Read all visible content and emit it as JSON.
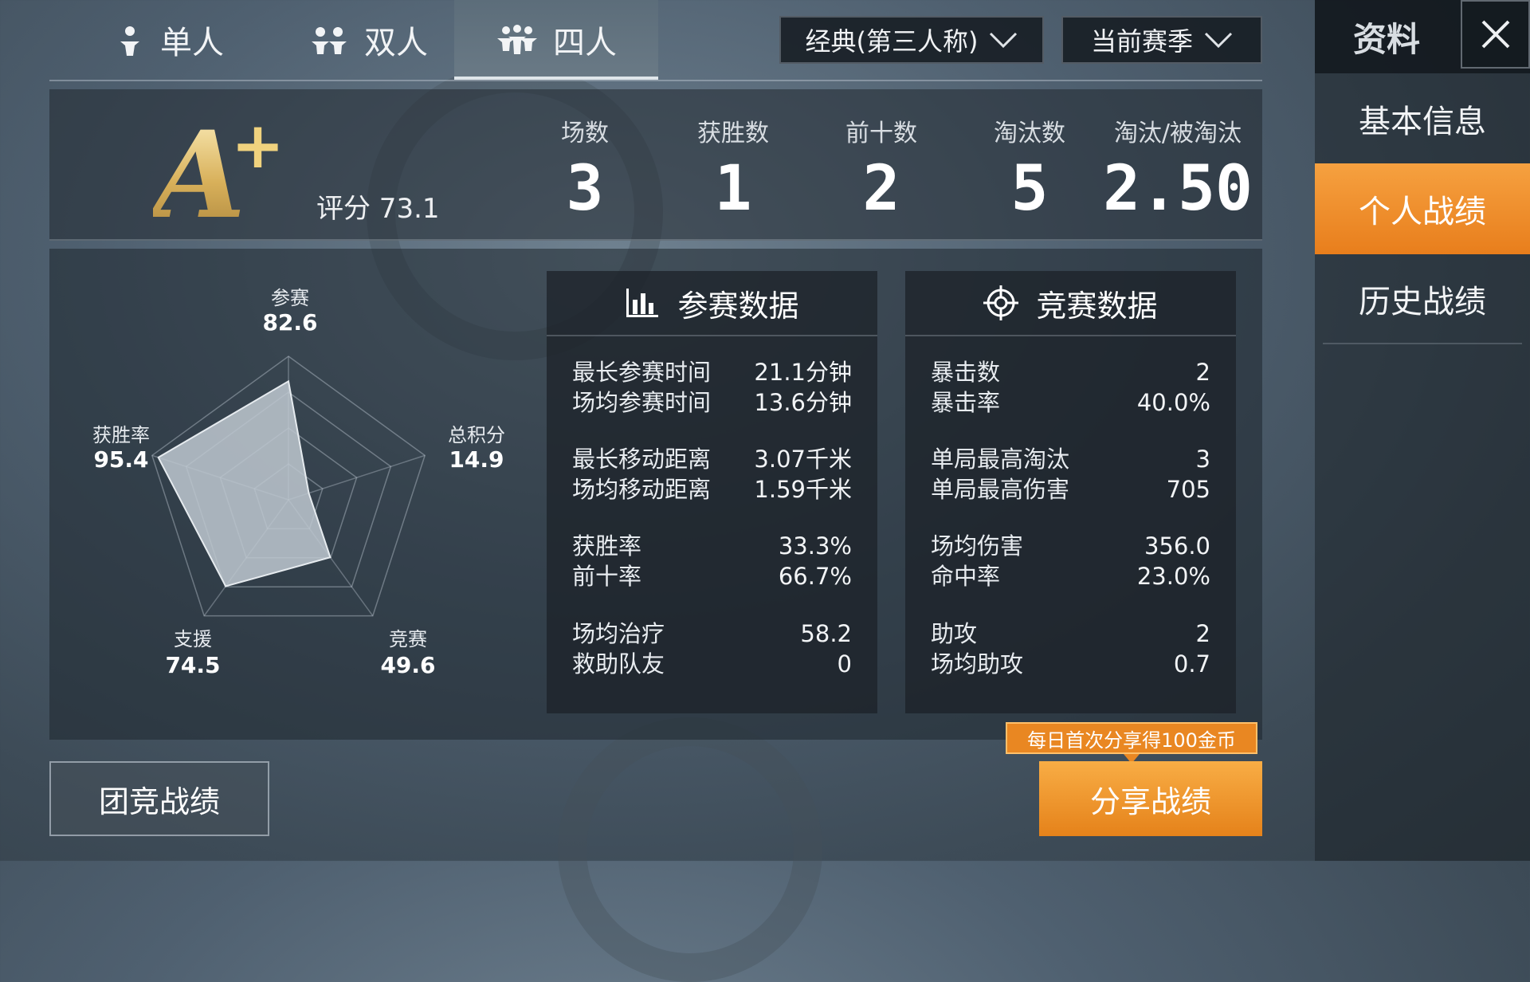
{
  "mode_tabs": [
    {
      "label": "单人",
      "icon": "single-player-icon"
    },
    {
      "label": "双人",
      "icon": "duo-icon"
    },
    {
      "label": "四人",
      "icon": "squad-icon"
    }
  ],
  "active_mode": "四人",
  "dropdowns": {
    "mode": "经典(第三人称)",
    "season": "当前赛季"
  },
  "side": {
    "title": "资料",
    "items": [
      "基本信息",
      "个人战绩",
      "历史战绩"
    ],
    "active": "个人战绩"
  },
  "summary": {
    "grade": "A",
    "grade_plus": "+",
    "score": "评分 73.1",
    "stats": [
      {
        "label": "场数",
        "value": "3"
      },
      {
        "label": "获胜数",
        "value": "1"
      },
      {
        "label": "前十数",
        "value": "2"
      },
      {
        "label": "淘汰数",
        "value": "5"
      },
      {
        "label": "淘汰/被淘汰",
        "value": "2.50"
      }
    ]
  },
  "radar": {
    "axes": [
      {
        "label": "参赛",
        "value": "82.6"
      },
      {
        "label": "总积分",
        "value": "14.9"
      },
      {
        "label": "竞赛",
        "value": "49.6"
      },
      {
        "label": "支援",
        "value": "74.5"
      },
      {
        "label": "获胜率",
        "value": "95.4"
      }
    ]
  },
  "participation": {
    "title": "参赛数据",
    "groups": [
      [
        [
          "最长参赛时间",
          "21.1分钟"
        ],
        [
          "场均参赛时间",
          "13.6分钟"
        ]
      ],
      [
        [
          "最长移动距离",
          "3.07千米"
        ],
        [
          "场均移动距离",
          "1.59千米"
        ]
      ],
      [
        [
          "获胜率",
          "33.3%"
        ],
        [
          "前十率",
          "66.7%"
        ]
      ],
      [
        [
          "场均治疗",
          "58.2"
        ],
        [
          "救助队友",
          "0"
        ]
      ]
    ]
  },
  "combat": {
    "title": "竞赛数据",
    "groups": [
      [
        [
          "暴击数",
          "2"
        ],
        [
          "暴击率",
          "40.0%"
        ]
      ],
      [
        [
          "单局最高淘汰",
          "3"
        ],
        [
          "单局最高伤害",
          "705"
        ]
      ],
      [
        [
          "场均伤害",
          "356.0"
        ],
        [
          "命中率",
          "23.0%"
        ]
      ],
      [
        [
          "助攻",
          "2"
        ],
        [
          "场均助攻",
          "0.7"
        ]
      ]
    ]
  },
  "buttons": {
    "team": "团竞战绩",
    "share": "分享战绩",
    "share_tip": "每日首次分享得100金币"
  },
  "colors": {
    "accent": "#e98722",
    "grade_gold": "#e9c978"
  }
}
